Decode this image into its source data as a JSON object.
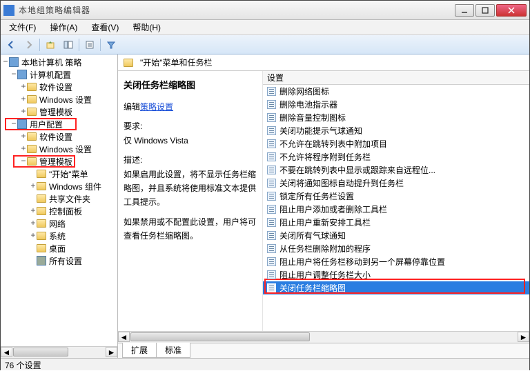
{
  "window": {
    "title": "本地组策略编辑器"
  },
  "menu": {
    "file": "文件(F)",
    "action": "操作(A)",
    "view": "查看(V)",
    "help": "帮助(H)"
  },
  "tree": {
    "root": "本地计算机 策略",
    "computer": "计算机配置",
    "c_soft": "软件设置",
    "c_win": "Windows 设置",
    "c_admin": "管理模板",
    "user": "用户配置",
    "u_soft": "软件设置",
    "u_win": "Windows 设置",
    "u_admin": "管理模板",
    "start": "\"开始\"菜单",
    "comp": "Windows 组件",
    "share": "共享文件夹",
    "cpanel": "控制面板",
    "net": "网络",
    "sys": "系统",
    "desk": "桌面",
    "all": "所有设置"
  },
  "header": {
    "title": "\"开始\"菜单和任务栏"
  },
  "desc": {
    "title": "关闭任务栏缩略图",
    "edit_prefix": "编辑",
    "edit_link": "策略设置",
    "req_label": "要求:",
    "req_text": "仅 Windows Vista",
    "d_label": "描述:",
    "d1": "如果启用此设置，将不显示任务栏缩略图，并且系统将使用标准文本提供工具提示。",
    "d2": "如果禁用或不配置此设置，用户将可查看任务栏缩略图。"
  },
  "list": {
    "col": "设置",
    "items": [
      "删除网络图标",
      "删除电池指示器",
      "删除音量控制图标",
      "关闭功能提示气球通知",
      "不允许在跳转列表中附加项目",
      "不允许将程序附到任务栏",
      "不要在跳转列表中显示或跟踪来自远程位...",
      "关闭将通知图标自动提升到任务栏",
      "锁定所有任务栏设置",
      "阻止用户添加或者删除工具栏",
      "阻止用户重新安排工具栏",
      "关闭所有气球通知",
      "从任务栏删除附加的程序",
      "阻止用户将任务栏移动到另一个屏幕停靠位置",
      "阻止用户调整任务栏大小",
      "关闭任务栏缩略图"
    ],
    "selected_index": 15
  },
  "tabs": {
    "ext": "扩展",
    "std": "标准"
  },
  "status": {
    "text": "76 个设置"
  }
}
